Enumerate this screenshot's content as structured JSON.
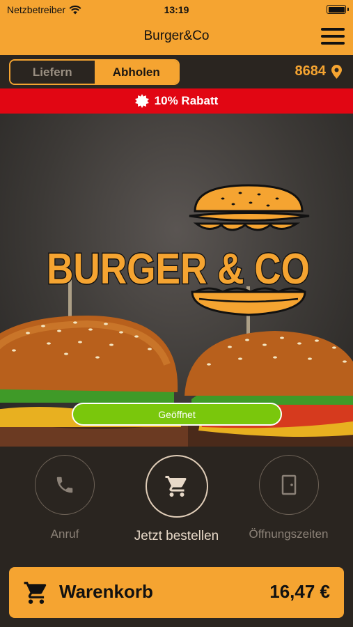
{
  "status_bar": {
    "carrier": "Netzbetreiber",
    "time": "13:19"
  },
  "header": {
    "title": "Burger&Co"
  },
  "order_mode": {
    "options": [
      "Liefern",
      "Abholen"
    ],
    "selected": "Abholen"
  },
  "location": {
    "postcode": "8684"
  },
  "promo": {
    "text": "10% Rabatt"
  },
  "hero": {
    "logo_text": "BURGER & CO",
    "open_status": "Geöffnet"
  },
  "actions": [
    {
      "label": "Anruf",
      "icon": "phone-icon"
    },
    {
      "label": "Jetzt bestellen",
      "icon": "cart-icon"
    },
    {
      "label": "Öffnungszeiten",
      "icon": "door-icon"
    }
  ],
  "cart": {
    "label": "Warenkorb",
    "total": "16,47 €"
  },
  "colors": {
    "accent": "#f5a431",
    "promo": "#e10613",
    "open": "#7ac70c",
    "background": "#2a2520"
  }
}
